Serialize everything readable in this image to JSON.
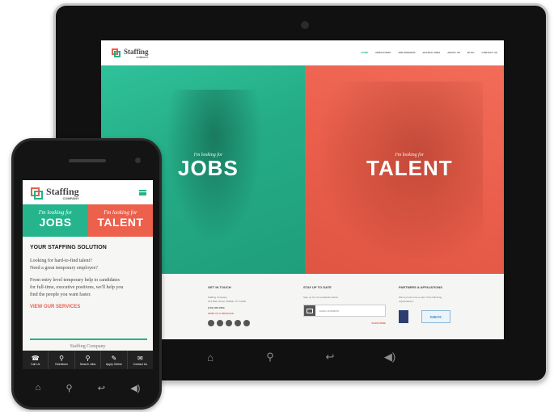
{
  "tablet": {
    "logo": {
      "main": "Staffing",
      "sub": "COMPANY"
    },
    "nav": [
      "HOME",
      "EMPLOYERS",
      "JOB SEEKERS",
      "SEARCH JOBS",
      "ABOUT US",
      "BLOG",
      "CONTACT US"
    ],
    "hero": {
      "jobs": {
        "lead": "I'm looking for",
        "word": "JOBS"
      },
      "talent": {
        "lead": "I'm looking for",
        "word": "TALENT"
      }
    },
    "footer": {
      "col1_lines": [
        "l",
        "l",
        "r",
        "ng candidates for",
        "r company find you"
      ],
      "contact": {
        "heading": "GET IN TOUCH",
        "line1": "Staffing Company",
        "line2": "123 Main Street, Buffalo, NY 14220",
        "phone": "(716) 456-7890",
        "link": "SEND US A MESSAGE"
      },
      "newsletter": {
        "heading": "STAY UP TO DATE",
        "text": "Sign up for our newsletter below",
        "placeholder": "EMAIL ADDRESS",
        "subscribe": "SUBSCRIBE"
      },
      "partners": {
        "heading": "PARTNERS & AFFILIATIONS",
        "text1": "We're proud to be a part of the following",
        "text2": "organizations:",
        "badge2": "WBENC"
      }
    },
    "hw_buttons": {
      "home": "⌂",
      "search": "⚲",
      "back": "↩",
      "volume": "◀)"
    }
  },
  "phone": {
    "logo": {
      "main": "Staffing",
      "sub": "COMPANY"
    },
    "tiles": {
      "jobs": {
        "lead": "I'm looking for",
        "word": "JOBS"
      },
      "talent": {
        "lead": "I'm looking for",
        "word": "TALENT"
      }
    },
    "content": {
      "heading": "YOUR STAFFING SOLUTION",
      "line1": "Looking for hard-to-find talent?",
      "line2": "Need a great temporary employee?",
      "para1": "From entry level temporary help to candidates",
      "para2": "for full-time, executive positions, we'll help you",
      "para3": "find the people you want faster.",
      "link": "VIEW OUR SERVICES"
    },
    "footer_name": "Staffing Company",
    "tabbar": [
      {
        "icon": "☎",
        "label": "Call Us"
      },
      {
        "icon": "⚲",
        "label": "Directions"
      },
      {
        "icon": "⚲",
        "label": "Search Jobs"
      },
      {
        "icon": "✎",
        "label": "Apply Online"
      },
      {
        "icon": "✉",
        "label": "Contact Us"
      }
    ],
    "hw_buttons": {
      "home": "⌂",
      "search": "⚲",
      "back": "↩",
      "volume": "◀)"
    }
  },
  "colors": {
    "green": "#25b48c",
    "coral": "#ec604c",
    "dark": "#141414"
  }
}
